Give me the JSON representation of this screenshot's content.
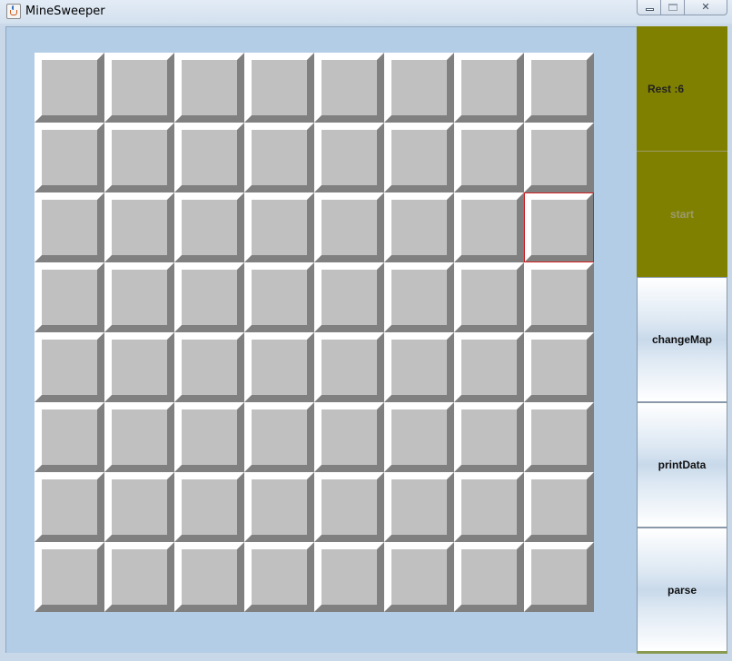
{
  "window": {
    "title": "MineSweeper",
    "controls": {
      "minimize": "minimize-icon",
      "maximize": "maximize-icon",
      "close": "✕"
    }
  },
  "board": {
    "rows": 8,
    "cols": 8,
    "selected_cell": {
      "row": 3,
      "col": 8
    },
    "colors": {
      "background": "#b4cde6",
      "tile_face": "#c0c0c0",
      "tile_highlight": "#ffffff",
      "tile_shadow": "#808080",
      "selection_border": "#d02020"
    }
  },
  "panel": {
    "rest_label": "Rest :6",
    "buttons": [
      {
        "id": "start",
        "label": "start"
      },
      {
        "id": "changeMap",
        "label": "changeMap"
      },
      {
        "id": "printData",
        "label": "printData"
      },
      {
        "id": "parse",
        "label": "parse"
      }
    ],
    "colors": {
      "info_bg": "#808000",
      "start_bg": "#808000",
      "start_text": "#9a9a70"
    }
  }
}
